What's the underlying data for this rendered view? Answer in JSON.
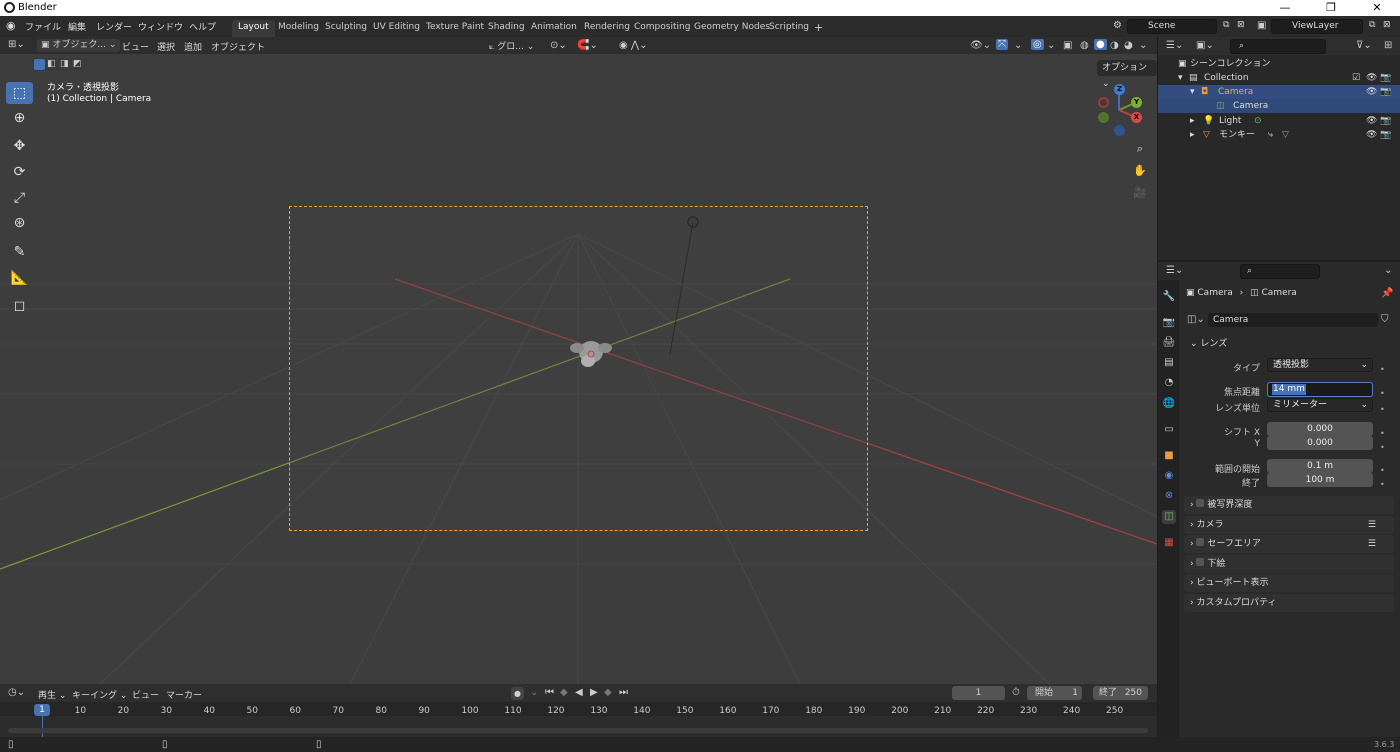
{
  "window": {
    "title": "Blender",
    "minimize": "—",
    "maximize": "❐",
    "close": "✕"
  },
  "menu": {
    "items": [
      "ファイル",
      "編集",
      "レンダー",
      "ウィンドウ",
      "ヘルプ"
    ]
  },
  "workspaces": {
    "tabs": [
      "Layout",
      "Modeling",
      "Sculpting",
      "UV Editing",
      "Texture Paint",
      "Shading",
      "Animation",
      "Rendering",
      "Compositing",
      "Geometry Nodes",
      "Scripting"
    ],
    "active": "Layout",
    "add": "+"
  },
  "scene": {
    "name": "Scene"
  },
  "viewlayer": {
    "name": "ViewLayer"
  },
  "viewport_header": {
    "mode": "オブジェク...",
    "menus": [
      "ビュー",
      "選択",
      "追加",
      "オブジェクト"
    ],
    "transform_orientation": "グロ...",
    "options": "オプション"
  },
  "viewport_overlay": {
    "line1": "カメラ・透視投影",
    "line2": "(1) Collection | Camera"
  },
  "gizmo": {
    "z": "Z",
    "y": "Y",
    "x": "X"
  },
  "outliner": {
    "header_root": "シーンコレクション",
    "rows": [
      {
        "label": "Collection"
      },
      {
        "label": "Camera"
      },
      {
        "label": "Camera"
      },
      {
        "label": "Light"
      },
      {
        "label": "モンキー"
      }
    ]
  },
  "properties": {
    "breadcrumb": {
      "object": "Camera",
      "data": "Camera"
    },
    "datablock": "Camera",
    "lens_panel": "レンズ",
    "type_label": "タイプ",
    "type_value": "透視投影",
    "focal_label": "焦点距離",
    "focal_value": "14 mm",
    "lens_unit_label": "レンズ単位",
    "lens_unit_value": "ミリメーター",
    "shift_x_label": "シフト X",
    "shift_x_value": "0.000",
    "shift_y_label": "Y",
    "shift_y_value": "0.000",
    "clip_start_label": "範囲の開始",
    "clip_start_value": "0.1 m",
    "clip_end_label": "終了",
    "clip_end_value": "100 m",
    "panels": [
      "被写界深度",
      "カメラ",
      "セーフエリア",
      "下絵",
      "ビューポート表示",
      "カスタムプロパティ"
    ]
  },
  "timeline": {
    "menus": [
      "再生",
      "キーイング",
      "ビュー",
      "マーカー"
    ],
    "current_frame": "1",
    "start_label": "開始",
    "start_value": "1",
    "end_label": "終了",
    "end_value": "250",
    "ticks": [
      "1",
      "10",
      "20",
      "30",
      "40",
      "50",
      "60",
      "70",
      "80",
      "90",
      "100",
      "110",
      "120",
      "130",
      "140",
      "150",
      "160",
      "170",
      "180",
      "190",
      "200",
      "210",
      "220",
      "230",
      "240",
      "250"
    ]
  },
  "status": {
    "version": "3.6.3"
  }
}
